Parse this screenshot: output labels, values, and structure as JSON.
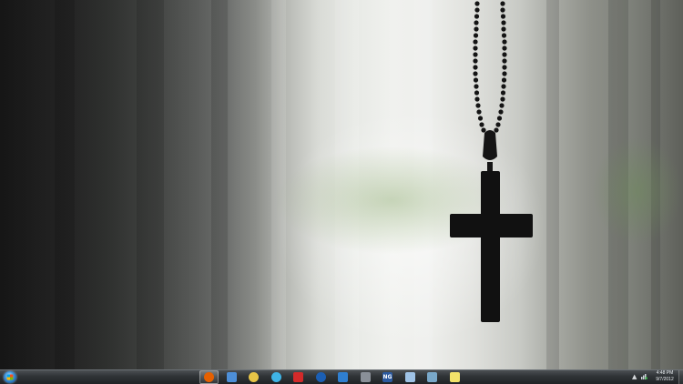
{
  "desktop": {
    "wallpaper": "cross-necklace-icon"
  },
  "taskbar": {
    "start_button": "windows-start-orb",
    "pinned": [
      {
        "name": "firefox-icon",
        "color": "#e66000",
        "active": true
      },
      {
        "name": "cloud-app-icon",
        "color": "#4d8fd8",
        "active": false
      },
      {
        "name": "lightbulb-icon",
        "color": "#e8c547",
        "active": false
      },
      {
        "name": "water-drop-icon",
        "color": "#3fb4e6",
        "active": false
      },
      {
        "name": "red-app-icon",
        "color": "#d32a2a",
        "active": false
      },
      {
        "name": "media-player-icon",
        "color": "#1b5fb5",
        "active": false
      },
      {
        "name": "pen-tool-icon",
        "color": "#2f7fd0",
        "active": false
      },
      {
        "name": "scanner-icon",
        "color": "#8a9098",
        "active": false
      },
      {
        "name": "ng-app-icon",
        "color": "#2c5aa0",
        "label": "NG",
        "active": false
      },
      {
        "name": "document-icon",
        "color": "#9fc3e6",
        "active": false
      },
      {
        "name": "screen-icon",
        "color": "#79a8c9",
        "active": false
      },
      {
        "name": "notes-icon",
        "color": "#f2e26a",
        "active": false
      }
    ],
    "clock": {
      "time": "4:48 PM",
      "date": "9/7/2012"
    }
  }
}
